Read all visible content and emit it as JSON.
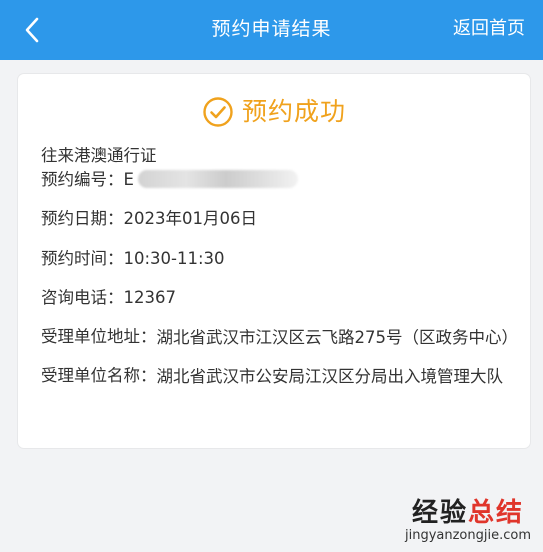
{
  "header": {
    "title": "预约申请结果",
    "home_label": "返回首页",
    "color": "#2d98ea"
  },
  "result": {
    "status_text": "预约成功",
    "status_color": "#f0a21d",
    "document_type": "往来港澳通行证",
    "booking_number_label": "预约编号：",
    "booking_number_visible": "E",
    "date_label": "预约日期：",
    "date_value": "2023年01月06日",
    "time_label": "预约时间：",
    "time_value": "10:30-11:30",
    "phone_label": "咨询电话：",
    "phone_value": "12367",
    "address_label": "受理单位地址：",
    "address_value": "湖北省武汉市江汉区云飞路275号（区政务中心）",
    "unit_label": "受理单位名称：",
    "unit_value": "湖北省武汉市公安局江汉区分局出入境管理大队"
  },
  "watermark": {
    "main_a": "经验",
    "main_b": "总结",
    "url": "jingyanzongjie.com"
  }
}
